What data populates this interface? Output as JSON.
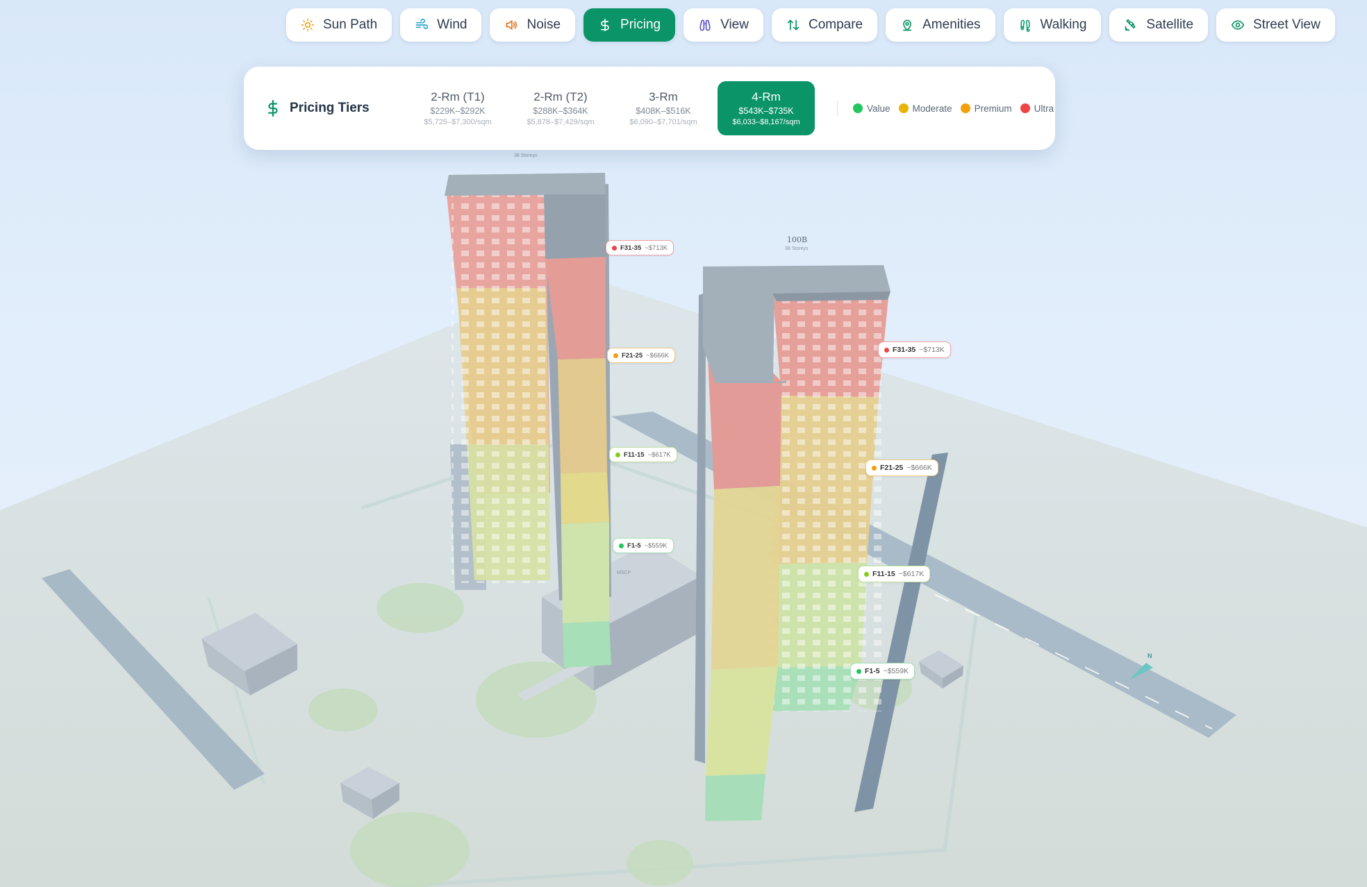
{
  "toolbar": {
    "items": [
      {
        "label": "Sun Path",
        "icon": "sun-icon",
        "color": "#e6a019"
      },
      {
        "label": "Wind",
        "icon": "wind-icon",
        "color": "#2ba6c9"
      },
      {
        "label": "Noise",
        "icon": "speaker-icon",
        "color": "#e2731f"
      },
      {
        "label": "Pricing",
        "icon": "dollar-icon",
        "color": "#ffffff",
        "active": true
      },
      {
        "label": "View",
        "icon": "binoculars-icon",
        "color": "#5a54c9"
      },
      {
        "label": "Compare",
        "icon": "compare-arrows-icon",
        "color": "#0b9467"
      },
      {
        "label": "Amenities",
        "icon": "location-pin-icon",
        "color": "#0b9467"
      },
      {
        "label": "Walking",
        "icon": "footprints-icon",
        "color": "#1a9e7a"
      },
      {
        "label": "Satellite",
        "icon": "satellite-icon",
        "color": "#0b9467"
      },
      {
        "label": "Street View",
        "icon": "eye-icon",
        "color": "#0b9467"
      }
    ]
  },
  "pricing_panel": {
    "title": "Pricing Tiers",
    "icon": "dollar-icon",
    "tiers": [
      {
        "name": "2-Rm (T1)",
        "price": "$229K–$292K",
        "psm": "$5,725–$7,300/sqm"
      },
      {
        "name": "2-Rm (T2)",
        "price": "$288K–$364K",
        "psm": "$5,878–$7,429/sqm"
      },
      {
        "name": "3-Rm",
        "price": "$408K–$516K",
        "psm": "$6,090–$7,701/sqm"
      },
      {
        "name": "4-Rm",
        "price": "$543K–$735K",
        "psm": "$6,033–$8,167/sqm",
        "active": true
      }
    ],
    "legend": [
      {
        "label": "Value",
        "color": "#22c55e"
      },
      {
        "label": "Moderate",
        "color": "#eab308"
      },
      {
        "label": "Premium",
        "color": "#f59e0b"
      },
      {
        "label": "Ultra",
        "color": "#ef4444"
      }
    ]
  },
  "scene": {
    "tower_a": {
      "storeys": "38 Storeys",
      "tags": [
        {
          "floors": "F31-35",
          "price": "~$713K",
          "color": "#ef4444"
        },
        {
          "floors": "F21-25",
          "price": "~$666K",
          "color": "#f59e0b"
        },
        {
          "floors": "F11-15",
          "price": "~$617K",
          "color": "#84cc16"
        },
        {
          "floors": "F1-5",
          "price": "~$559K",
          "color": "#22c55e"
        }
      ]
    },
    "tower_b": {
      "name": "100B",
      "storeys": "38 Storeys",
      "tags": [
        {
          "floors": "F31-35",
          "price": "~$713K",
          "color": "#ef4444"
        },
        {
          "floors": "F21-25",
          "price": "~$666K",
          "color": "#f59e0b"
        },
        {
          "floors": "F11-15",
          "price": "~$617K",
          "color": "#84cc16"
        },
        {
          "floors": "F1-5",
          "price": "~$559K",
          "color": "#22c55e"
        }
      ]
    },
    "podium_label": "MSCP",
    "compass": "N"
  }
}
